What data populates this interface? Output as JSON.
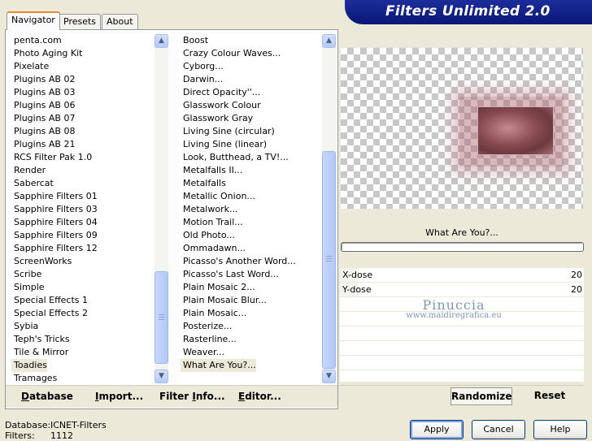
{
  "banner": {
    "title": "Filters Unlimited 2.0"
  },
  "tabs": [
    {
      "label": "Navigator",
      "active": true
    },
    {
      "label": "Presets",
      "active": false
    },
    {
      "label": "About",
      "active": false
    }
  ],
  "categories": [
    {
      "label": "penta.com"
    },
    {
      "label": "Photo Aging Kit"
    },
    {
      "label": "Pixelate"
    },
    {
      "label": "Plugins AB 02"
    },
    {
      "label": "Plugins AB 03"
    },
    {
      "label": "Plugins AB 06"
    },
    {
      "label": "Plugins AB 07"
    },
    {
      "label": "Plugins AB 08"
    },
    {
      "label": "Plugins AB 21"
    },
    {
      "label": "RCS Filter Pak 1.0"
    },
    {
      "label": "Render"
    },
    {
      "label": "Sabercat"
    },
    {
      "label": "Sapphire Filters 01"
    },
    {
      "label": "Sapphire Filters 03"
    },
    {
      "label": "Sapphire Filters 04"
    },
    {
      "label": "Sapphire Filters 09"
    },
    {
      "label": "Sapphire Filters 12"
    },
    {
      "label": "ScreenWorks"
    },
    {
      "label": "Scribe"
    },
    {
      "label": "Simple"
    },
    {
      "label": "Special Effects 1"
    },
    {
      "label": "Special Effects 2"
    },
    {
      "label": "Sybia"
    },
    {
      "label": "Teph's Tricks"
    },
    {
      "label": "Tile & Mirror"
    },
    {
      "label": "Toadies",
      "selected": true
    },
    {
      "label": "Tramages"
    }
  ],
  "filters": [
    {
      "label": "Boost"
    },
    {
      "label": "Crazy Colour Waves..."
    },
    {
      "label": "Cyborg..."
    },
    {
      "label": "Darwin..."
    },
    {
      "label": "Direct Opacity''..."
    },
    {
      "label": "Glasswork Colour"
    },
    {
      "label": "Glasswork Gray"
    },
    {
      "label": "Living Sine (circular)"
    },
    {
      "label": "Living Sine (linear)"
    },
    {
      "label": "Look, Butthead, a TV!..."
    },
    {
      "label": "Metalfalls II..."
    },
    {
      "label": "Metalfalls"
    },
    {
      "label": "Metallic Onion..."
    },
    {
      "label": "Metalwork..."
    },
    {
      "label": "Motion Trail..."
    },
    {
      "label": "Old Photo..."
    },
    {
      "label": "Ommadawn..."
    },
    {
      "label": "Picasso's Another Word..."
    },
    {
      "label": "Picasso's Last Word..."
    },
    {
      "label": "Plain Mosaic 2..."
    },
    {
      "label": "Plain Mosaic Blur..."
    },
    {
      "label": "Plain Mosaic..."
    },
    {
      "label": "Posterize..."
    },
    {
      "label": "Rasterline..."
    },
    {
      "label": "Weaver..."
    },
    {
      "label": "What Are You?...",
      "selected": true
    }
  ],
  "left_buttons": {
    "database": {
      "u": "D",
      "rest": "atabase"
    },
    "import": {
      "u": "I",
      "rest": "mport..."
    },
    "filter_info": {
      "pre": "Filter ",
      "u": "I",
      "rest": "nfo..."
    },
    "editor": {
      "u": "E",
      "rest": "ditor..."
    }
  },
  "selected_filter_name": "What Are You?...",
  "parameters": [
    {
      "label": "X-dose",
      "value": "20",
      "fraction": 0.078
    },
    {
      "label": "Y-dose",
      "value": "20",
      "fraction": 0.078
    }
  ],
  "watermark": {
    "name": "Pinuccia",
    "url": "www.maidiregrafica.eu"
  },
  "right_buttons": {
    "randomize": "Randomize",
    "reset": "Reset"
  },
  "status": {
    "database_label": "Database:",
    "database_value": "ICNET-Filters",
    "filters_label": "Filters:",
    "filters_value": "1112"
  },
  "dialog_buttons": {
    "apply": "Apply",
    "cancel": "Cancel",
    "help": "Help"
  },
  "colors": {
    "banner": "#0a1776",
    "tab_accent": "#e68b2c",
    "dialog_bg": "#ece9d8"
  }
}
